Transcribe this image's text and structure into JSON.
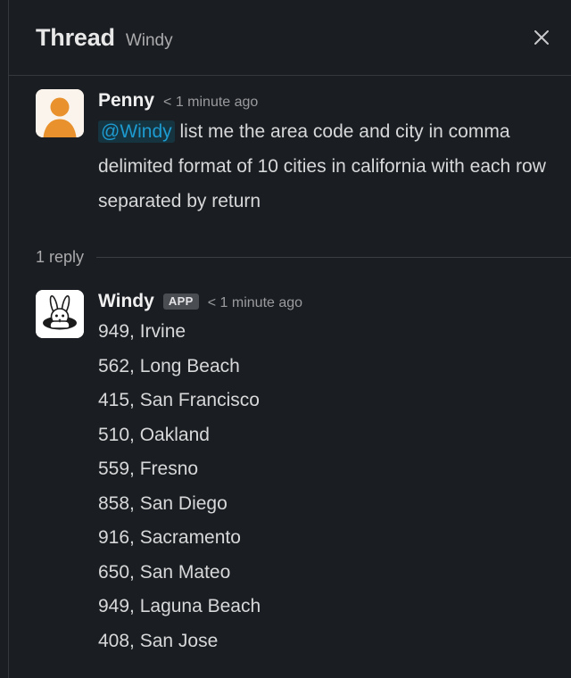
{
  "header": {
    "title": "Thread",
    "subtitle": "Windy",
    "close_icon": "close-icon"
  },
  "root_message": {
    "author": "Penny",
    "timestamp": "< 1 minute ago",
    "avatar_icon": "user-avatar-icon",
    "mention": "@Windy",
    "text": " list me the area code and city in comma delimited format of 10 cities in california with each row separated by return"
  },
  "replies_divider": {
    "count_label": "1 reply"
  },
  "reply_message": {
    "author": "Windy",
    "badge": "APP",
    "timestamp": "< 1 minute ago",
    "avatar_icon": "rabbit-avatar-icon",
    "lines": [
      "949, Irvine",
      "562, Long Beach",
      "415, San Francisco",
      "510, Oakland",
      "559, Fresno",
      "858, San Diego",
      "916, Sacramento",
      "650, San Mateo",
      "949, Laguna Beach",
      "408, San Jose"
    ]
  },
  "colors": {
    "background": "#1a1d21",
    "divider": "#35383d",
    "text_primary": "#d7d8d9",
    "text_muted": "#ababad",
    "mention_text": "#1d9bd1",
    "mention_bg": "#16343f",
    "badge_bg": "#4a4d52",
    "avatar_bg": "#faf4ec",
    "avatar_fg": "#e8912d"
  }
}
